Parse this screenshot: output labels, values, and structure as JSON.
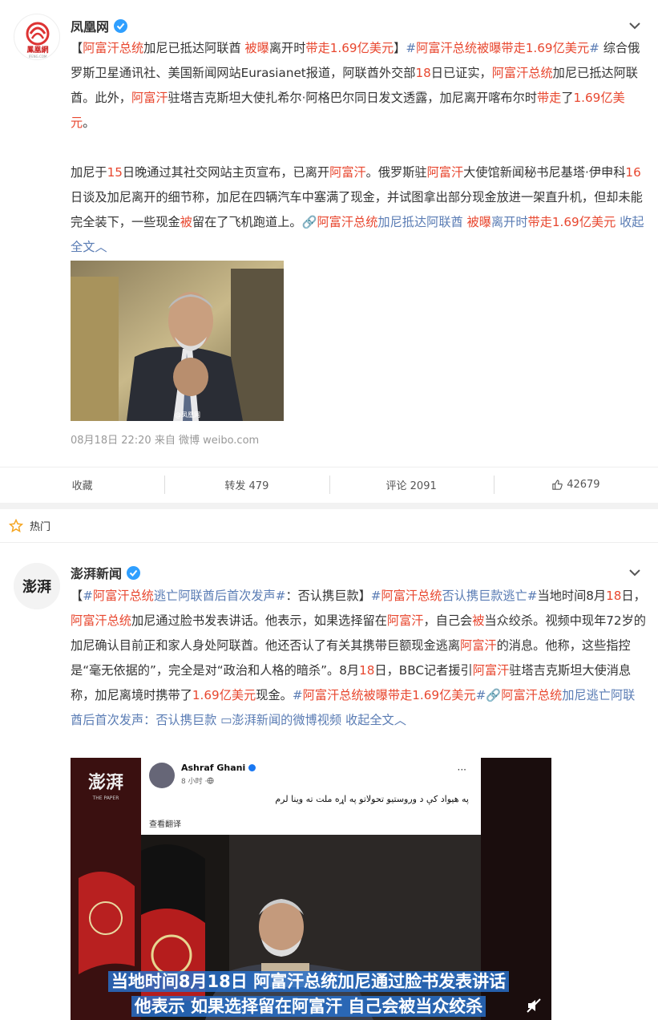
{
  "post1": {
    "author": "凤凰网",
    "avatar_text": "鳳凰網",
    "avatar_sub": "IFENG.COM",
    "para1": [
      {
        "t": "【",
        "c": "d"
      },
      {
        "t": "阿富汗总统",
        "c": "r"
      },
      {
        "t": "加尼已抵达阿联酋 ",
        "c": "d"
      },
      {
        "t": "被曝",
        "c": "r"
      },
      {
        "t": "离开时",
        "c": "d"
      },
      {
        "t": "带走1.69亿美元",
        "c": "r"
      },
      {
        "t": "】",
        "c": "d"
      },
      {
        "t": "#",
        "c": "l"
      },
      {
        "t": "阿富汗总统被曝带走1.69亿美元",
        "c": "r"
      },
      {
        "t": "#",
        "c": "l"
      },
      {
        "t": " 综合俄罗斯卫星通讯社、美国新闻网站Eurasianet报道，阿联酋外交部",
        "c": "d"
      },
      {
        "t": "18",
        "c": "r"
      },
      {
        "t": "日已证实，",
        "c": "d"
      },
      {
        "t": "阿富汗总统",
        "c": "r"
      },
      {
        "t": "加尼已抵达阿联酋。此外，",
        "c": "d"
      },
      {
        "t": "阿富汗",
        "c": "r"
      },
      {
        "t": "驻塔吉克斯坦大使扎希尔·阿格巴尔同日发文透露，加尼离开喀布尔时",
        "c": "d"
      },
      {
        "t": "带走",
        "c": "r"
      },
      {
        "t": "了",
        "c": "d"
      },
      {
        "t": "1.69亿美元",
        "c": "r"
      },
      {
        "t": "。",
        "c": "d"
      }
    ],
    "para2": [
      {
        "t": "加尼于",
        "c": "d"
      },
      {
        "t": "15",
        "c": "r"
      },
      {
        "t": "日晚通过其社交网站主页宣布，已离开",
        "c": "d"
      },
      {
        "t": "阿富汗",
        "c": "r"
      },
      {
        "t": "。俄罗斯驻",
        "c": "d"
      },
      {
        "t": "阿富汗",
        "c": "r"
      },
      {
        "t": "大使馆新闻秘书尼基塔·伊申科",
        "c": "d"
      },
      {
        "t": "16",
        "c": "r"
      },
      {
        "t": "日谈及加尼离开的细节称，加尼在四辆汽车中塞满了现金，并试图拿出部分现金放进一架直升机，但却未能完全装下，一些现金",
        "c": "d"
      },
      {
        "t": "被",
        "c": "r"
      },
      {
        "t": "留在了飞机跑道上。",
        "c": "d"
      },
      {
        "t": "🔗",
        "c": "l"
      },
      {
        "t": "阿富汗总统",
        "c": "r"
      },
      {
        "t": "加尼抵达阿联酋 ",
        "c": "l"
      },
      {
        "t": "被曝",
        "c": "r"
      },
      {
        "t": "离开时",
        "c": "l"
      },
      {
        "t": "带走1.69亿美元",
        "c": "r"
      },
      {
        "t": " 收起全文︿",
        "c": "l"
      }
    ],
    "watermark": "@凤凰网",
    "meta": "08月18日 22:20  来自 微博 weibo.com",
    "actions": {
      "collect": "收藏",
      "repost": "转发 479",
      "comment": "评论 2091",
      "like": "42679"
    }
  },
  "hot_label": "热门",
  "post2": {
    "author": "澎湃新闻",
    "avatar_text": "澎湃",
    "body": [
      {
        "t": "【",
        "c": "d"
      },
      {
        "t": "#",
        "c": "l"
      },
      {
        "t": "阿富汗总统",
        "c": "r"
      },
      {
        "t": "逃亡阿联酋后首次发声#",
        "c": "l"
      },
      {
        "t": "：否认携巨款】",
        "c": "d"
      },
      {
        "t": "#",
        "c": "l"
      },
      {
        "t": "阿富汗总统",
        "c": "r"
      },
      {
        "t": "否认携巨款逃亡#",
        "c": "l"
      },
      {
        "t": "当地时间8月",
        "c": "d"
      },
      {
        "t": "18",
        "c": "r"
      },
      {
        "t": "日，",
        "c": "d"
      },
      {
        "t": "阿富汗总统",
        "c": "r"
      },
      {
        "t": "加尼通过脸书发表讲话。他表示，如果选择留在",
        "c": "d"
      },
      {
        "t": "阿富汗",
        "c": "r"
      },
      {
        "t": "，自己会",
        "c": "d"
      },
      {
        "t": "被",
        "c": "r"
      },
      {
        "t": "当众绞杀。视频中现年72岁的加尼确认目前正和家人身处阿联酋。他还否认了有关其携带巨额现金逃离",
        "c": "d"
      },
      {
        "t": "阿富汗",
        "c": "r"
      },
      {
        "t": "的消息。他称，这些指控是“毫无依据的”，完全是对“政治和人格的暗杀”。8月",
        "c": "d"
      },
      {
        "t": "18",
        "c": "r"
      },
      {
        "t": "日，BBC记者援引",
        "c": "d"
      },
      {
        "t": "阿富汗",
        "c": "r"
      },
      {
        "t": "驻塔吉克斯坦大使消息称，加尼离境时携带了",
        "c": "d"
      },
      {
        "t": "1.69亿美元",
        "c": "r"
      },
      {
        "t": "现金。",
        "c": "d"
      },
      {
        "t": "#",
        "c": "l"
      },
      {
        "t": "阿富汗总统被曝带走1.69亿美元",
        "c": "r"
      },
      {
        "t": "#",
        "c": "l"
      },
      {
        "t": "🔗",
        "c": "l"
      },
      {
        "t": "阿富汗总统",
        "c": "r"
      },
      {
        "t": "加尼逃亡阿联酋后首次发声：否认携巨款 ",
        "c": "l"
      },
      {
        "t": "▭澎湃新闻的微博视频",
        "c": "l"
      },
      {
        "t": " 收起全文︿",
        "c": "l"
      }
    ],
    "video": {
      "logo": "澎湃",
      "logo_sub": "THE PAPER",
      "fb_name": "Ashraf Ghani",
      "fb_time": "8 小时 · ",
      "fb_text": "په هیواد کې د وروستیو تحولاتو په اړه ملت ته وینا لرم",
      "fb_translate": "查看翻译",
      "fb_more": "···",
      "subtitle1": "当地时间8月18日 阿富汗总统加尼通过脸书发表讲话",
      "subtitle2": "他表示 如果选择留在阿富汗 自己会被当众绞杀"
    }
  },
  "colors": {
    "red": "#e8472f",
    "link": "#5a7cb4",
    "verified": "#2f9fff"
  }
}
